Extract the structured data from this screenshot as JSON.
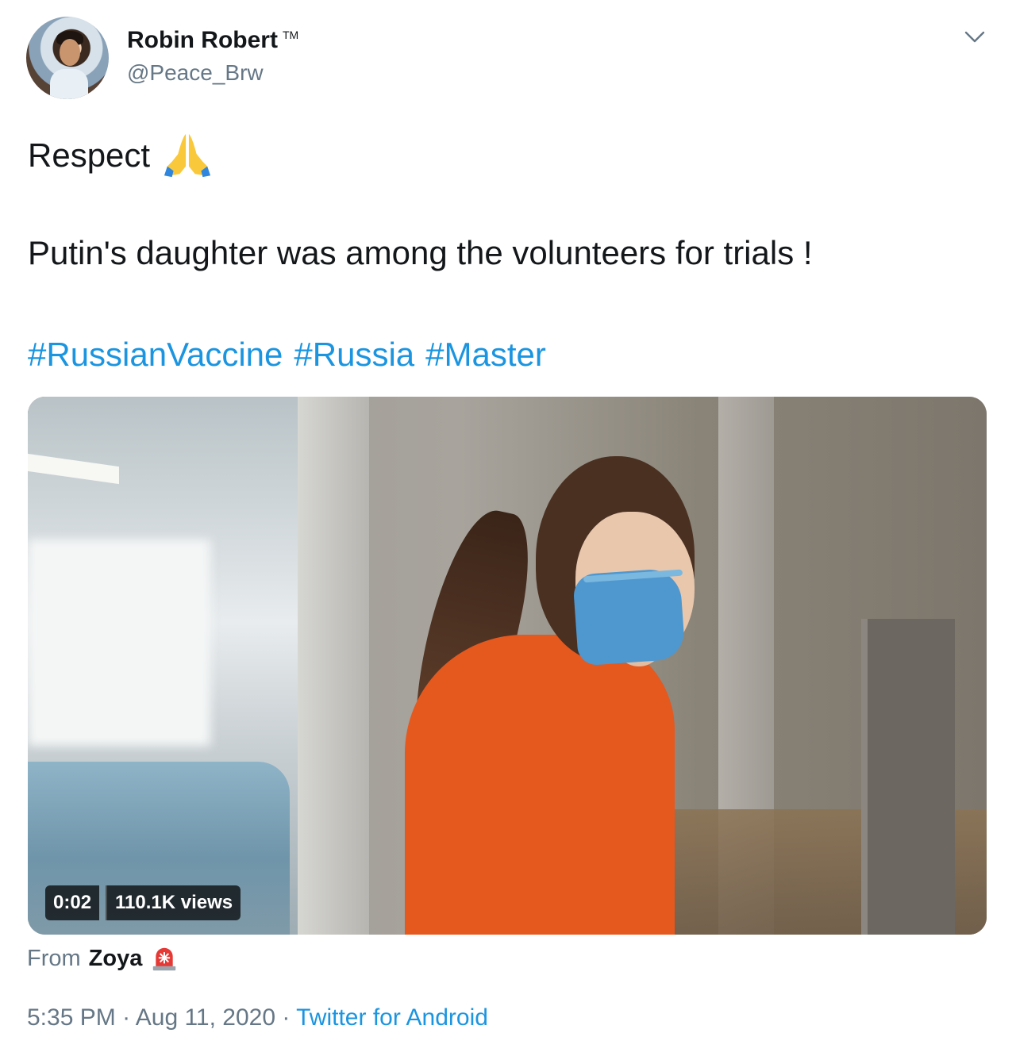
{
  "author": {
    "name": "Robin Robert",
    "tm": "TM",
    "handle": "@Peace_Brw",
    "avatar_icon": "profile-photo"
  },
  "tweet": {
    "line1": "Respect",
    "line1_emoji": "folded-hands-emoji",
    "line2": "Putin's daughter was among the volunteers for trials !",
    "hashtags": [
      "#RussianVaccine",
      "#Russia",
      "#Master"
    ]
  },
  "media": {
    "duration": "0:02",
    "views": "110.1K views",
    "kind": "video"
  },
  "source": {
    "prefix": "From",
    "name": "Zoya",
    "icon": "siren-emoji"
  },
  "meta": {
    "time": "5:35 PM",
    "sep1": " · ",
    "date": "Aug 11, 2020",
    "sep2": " · ",
    "app": "Twitter for Android"
  },
  "colors": {
    "link": "#1b95e0",
    "text": "#14171a",
    "muted": "#657786"
  }
}
